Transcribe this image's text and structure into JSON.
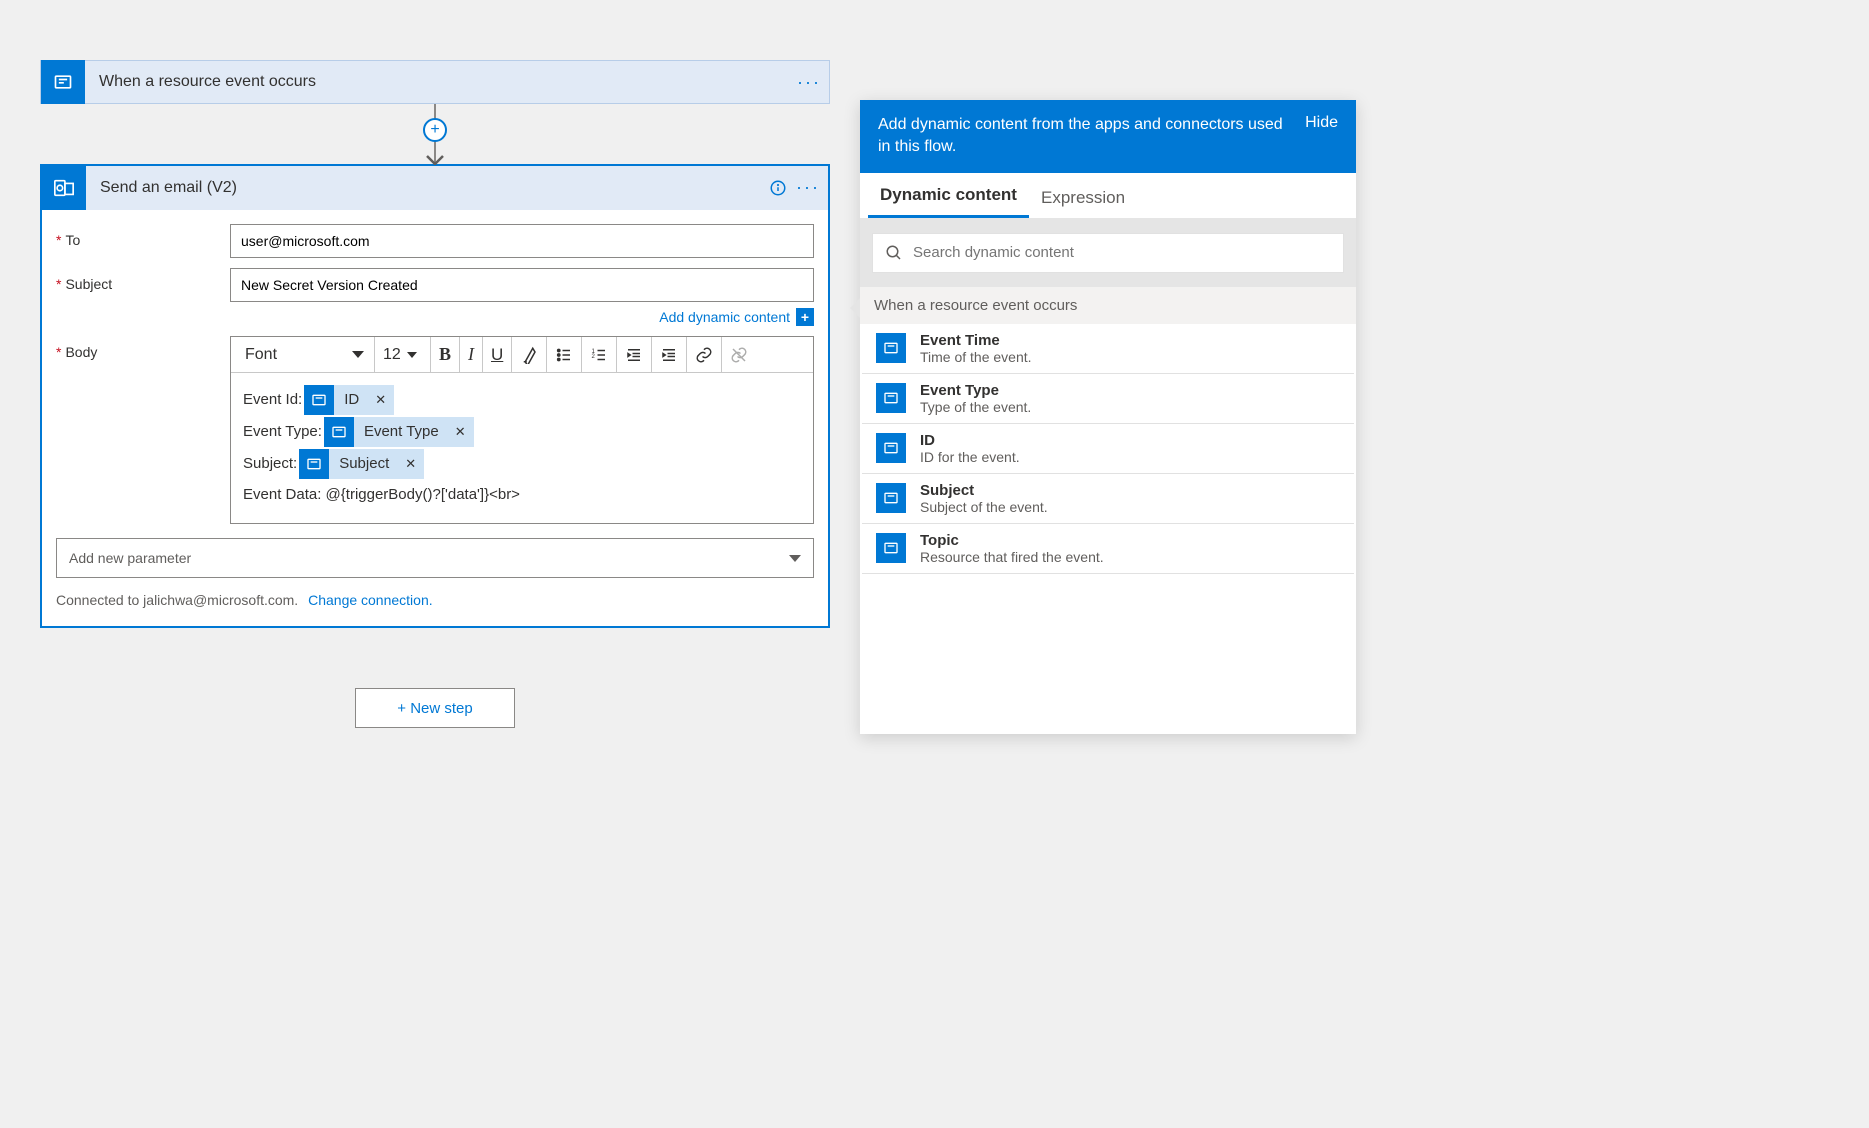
{
  "trigger": {
    "title": "When a resource event occurs"
  },
  "action": {
    "title": "Send an email (V2)",
    "fields": {
      "to_label": "To",
      "subject_label": "Subject",
      "body_label": "Body",
      "to_value": "user@microsoft.com",
      "subject_value": "New Secret Version Created"
    },
    "body": {
      "font_label": "Font",
      "font_size": "12",
      "lines": {
        "l1_prefix": "Event Id:",
        "l1_token": "ID",
        "l2_prefix": "Event Type:",
        "l2_token": "Event Type",
        "l3_prefix": "Subject:",
        "l3_token": "Subject",
        "l4": "Event Data: @{triggerBody()?['data']}<br>"
      }
    },
    "add_dynamic_label": "Add dynamic content",
    "add_param_label": "Add new parameter",
    "connection_text": "Connected to jalichwa@microsoft.com.",
    "change_conn_label": "Change connection."
  },
  "new_step_label": "+ New step",
  "panel": {
    "header_text": "Add dynamic content from the apps and connectors used in this flow.",
    "hide_label": "Hide",
    "tabs": {
      "dynamic": "Dynamic content",
      "expression": "Expression"
    },
    "search_placeholder": "Search dynamic content",
    "section_title": "When a resource event occurs",
    "items": [
      {
        "name": "Event Time",
        "desc": "Time of the event."
      },
      {
        "name": "Event Type",
        "desc": "Type of the event."
      },
      {
        "name": "ID",
        "desc": "ID for the event."
      },
      {
        "name": "Subject",
        "desc": "Subject of the event."
      },
      {
        "name": "Topic",
        "desc": "Resource that fired the event."
      }
    ]
  }
}
